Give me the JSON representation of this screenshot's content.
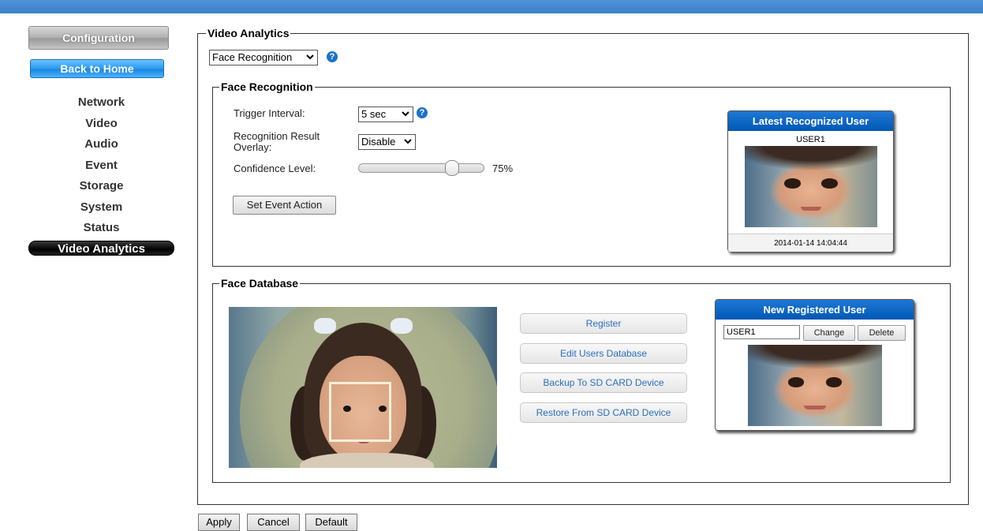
{
  "sidebar": {
    "config_label": "Configuration",
    "home_label": "Back to Home",
    "nav": [
      "Network",
      "Video",
      "Audio",
      "Event",
      "Storage",
      "System",
      "Status",
      "Video Analytics"
    ],
    "active": "Video Analytics"
  },
  "main": {
    "title": "Video Analytics",
    "mode_select": "Face Recognition",
    "help_glyph": "?",
    "face_recognition": {
      "title": "Face Recognition",
      "trigger_label": "Trigger Interval:",
      "trigger_value": "5 sec",
      "overlay_label_1": "Recognition Result",
      "overlay_label_2": "Overlay:",
      "overlay_value": "Disable",
      "confidence_label": "Confidence Level:",
      "confidence_value": "75%",
      "confidence_fraction": 0.75,
      "event_button": "Set Event Action",
      "latest_card": {
        "title": "Latest Recognized User",
        "user": "USER1",
        "timestamp": "2014-01-14 14:04:44"
      }
    },
    "face_database": {
      "title": "Face Database",
      "buttons": {
        "register": "Register",
        "edit": "Edit Users Database",
        "backup": "Backup To SD CARD Device",
        "restore": "Restore From SD CARD Device"
      },
      "new_card": {
        "title": "New Registered User",
        "user_value": "USER1",
        "change": "Change",
        "delete": "Delete"
      }
    }
  },
  "footer": {
    "apply": "Apply",
    "cancel": "Cancel",
    "default": "Default"
  },
  "colors": {
    "accent_blue": "#0b63c4",
    "home_blue": "#2a9af0",
    "topbar": "#4a8fd6"
  },
  "icons": [
    "help-icon",
    "chevron-down-icon"
  ]
}
